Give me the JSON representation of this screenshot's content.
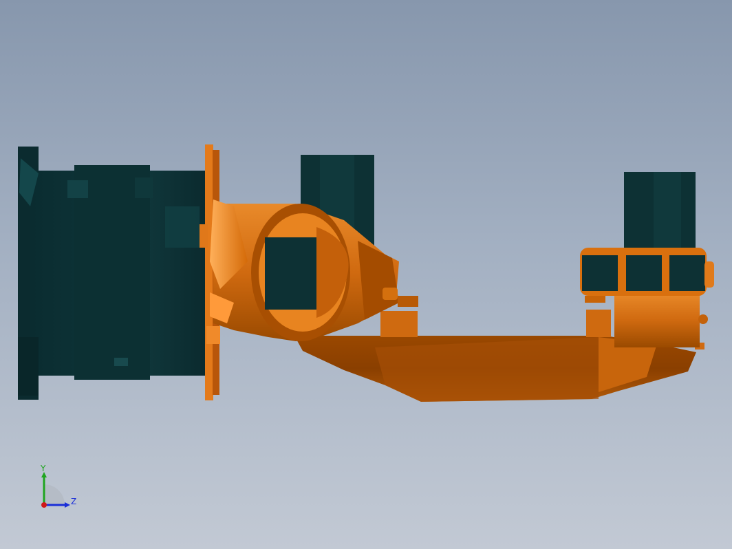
{
  "viewport": {
    "background_top": "#8797ad",
    "background_bottom": "#c2c9d4"
  },
  "model": {
    "body_color": "#d96a0a",
    "body_shade": "#8a3e00",
    "motor_color": "#0e3236"
  },
  "triad": {
    "y_label": "Y",
    "z_label": "Z",
    "y_color": "#1fa51f",
    "z_color": "#1a2ed8",
    "x_color": "#d01818"
  }
}
